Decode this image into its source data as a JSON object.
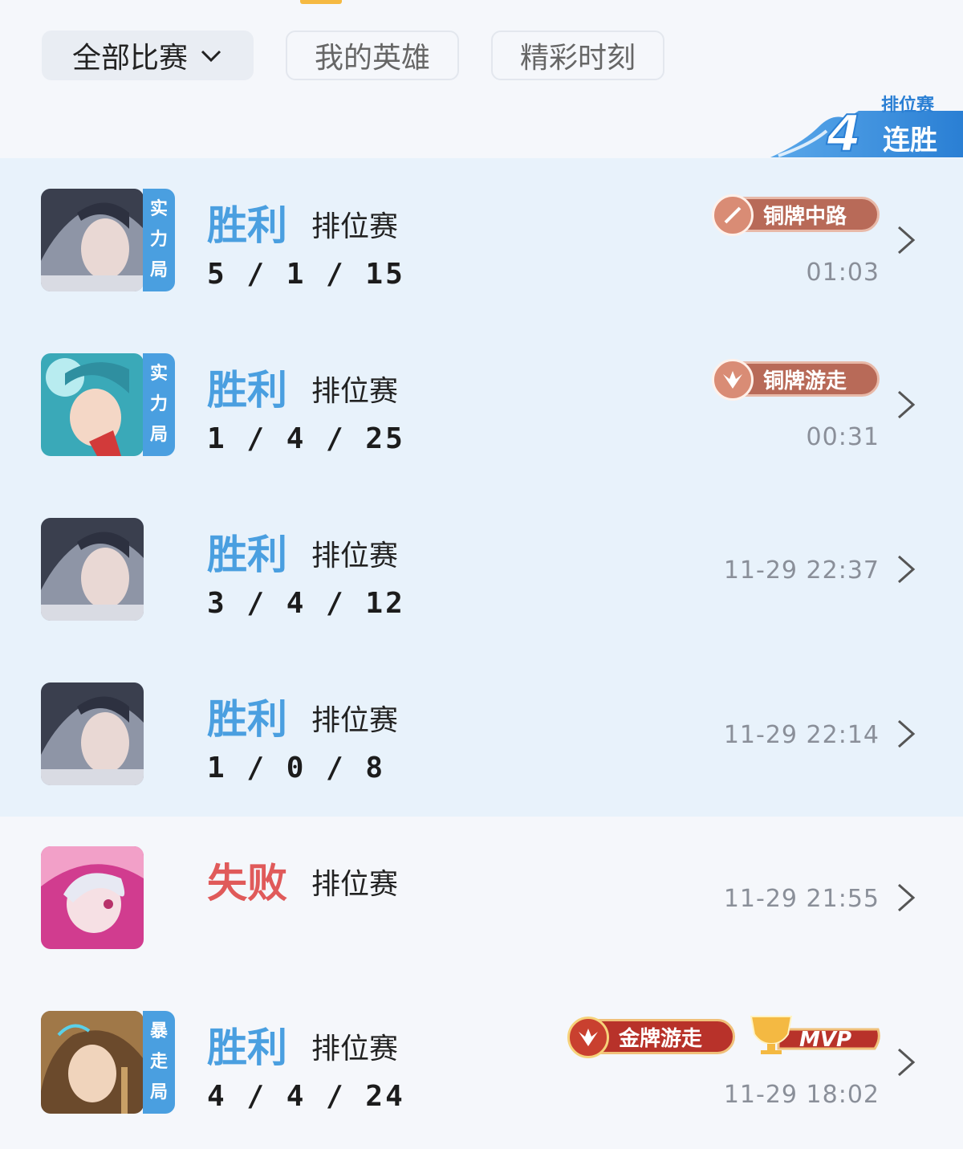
{
  "filters": {
    "all_matches": "全部比赛",
    "my_heroes": "我的英雄",
    "highlights": "精彩时刻"
  },
  "streak_badge": {
    "mode": "排位赛",
    "count": "4",
    "label": "连胜"
  },
  "matches": [
    {
      "avatar": "hero-portrait-dark-hair",
      "mode_tag": [
        "实",
        "力",
        "局"
      ],
      "result": "胜利",
      "type": "排位赛",
      "kda": "5 / 1 / 15",
      "time": "01:03",
      "badge": "铜牌中路",
      "badge_icon": "sword-icon"
    },
    {
      "avatar": "hero-portrait-teal-hair",
      "mode_tag": [
        "实",
        "力",
        "局"
      ],
      "result": "胜利",
      "type": "排位赛",
      "kda": "1 / 4 / 25",
      "time": "00:31",
      "badge": "铜牌游走",
      "badge_icon": "wings-icon"
    },
    {
      "avatar": "hero-portrait-dark-hair",
      "result": "胜利",
      "type": "排位赛",
      "kda": "3 / 4 / 12",
      "time": "11-29 22:37"
    },
    {
      "avatar": "hero-portrait-dark-hair",
      "result": "胜利",
      "type": "排位赛",
      "kda": "1 / 0 / 8",
      "time": "11-29 22:14"
    },
    {
      "avatar": "hero-portrait-silver-hair",
      "result": "失败",
      "type": "排位赛",
      "kda": "",
      "time": "11-29 21:55"
    },
    {
      "avatar": "hero-portrait-brown-hair",
      "mode_tag": [
        "暴",
        "走",
        "局"
      ],
      "result": "胜利",
      "type": "排位赛",
      "kda": "4 / 4 / 24",
      "time": "11-29 18:02",
      "badge": "金牌游走",
      "badge_icon": "wings-icon",
      "mvp": "MVP"
    }
  ],
  "colors": {
    "win": "#4a9fe0",
    "loss": "#e05a5a",
    "highlight_bg": "#e8f2fb",
    "bronze_badge": "#b86a58",
    "gold_badge": "#b8322a"
  }
}
